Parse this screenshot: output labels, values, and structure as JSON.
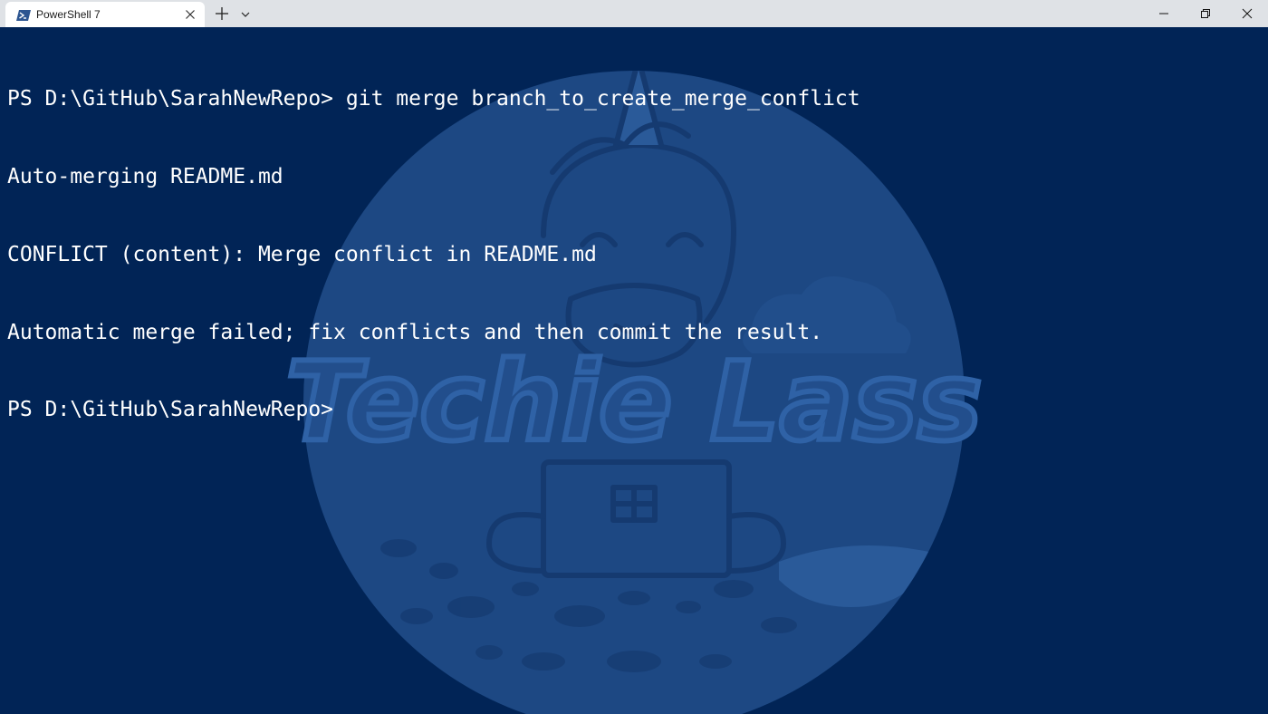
{
  "app": {
    "tab_title": "PowerShell 7",
    "tab_icon": "powershell-icon",
    "colors": {
      "terminal_background": "#012456",
      "terminal_text": "#ffffff",
      "titlebar_background": "#dfe2e6",
      "watermark": "#1e4a86"
    }
  },
  "titlebar": {
    "new_tab_icon": "plus-icon",
    "dropdown_icon": "chevron-down-icon",
    "minimize_icon": "minimize-icon",
    "maximize_icon": "restore-icon",
    "close_icon": "close-icon"
  },
  "terminal": {
    "lines": [
      {
        "prompt": "PS D:\\GitHub\\SarahNewRepo> ",
        "command": "git merge branch_to_create_merge_conflict"
      },
      {
        "text": "Auto-merging README.md"
      },
      {
        "text": "CONFLICT (content): Merge conflict in README.md"
      },
      {
        "text": "Automatic merge failed; fix conflicts and then commit the result."
      },
      {
        "prompt": "PS D:\\GitHub\\SarahNewRepo>",
        "command": ""
      }
    ],
    "background_logo_text": "Techie Lass"
  }
}
